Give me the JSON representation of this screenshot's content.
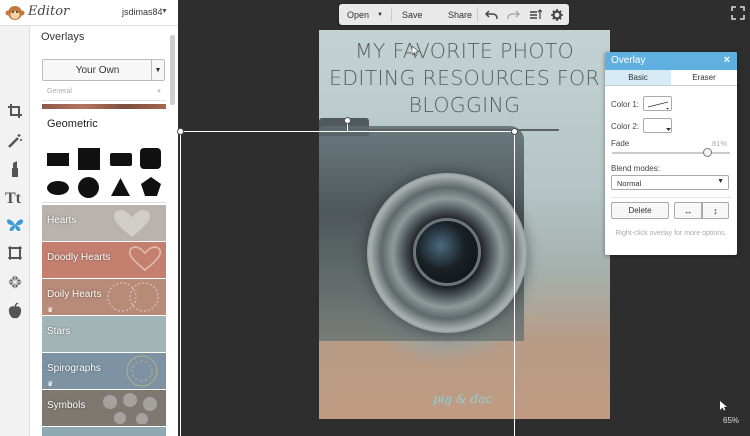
{
  "app": {
    "logo_text": "Editor",
    "username": "jsdimas84"
  },
  "panel": {
    "title": "Overlays",
    "your_own_label": "Your Own",
    "category_placeholder": "General",
    "geometric_label": "Geometric",
    "categories": [
      {
        "label": "Hearts",
        "color": "#b9b2ad",
        "premium": false
      },
      {
        "label": "Doodly Hearts",
        "color": "#c47f6f",
        "premium": false
      },
      {
        "label": "Doily Hearts",
        "color": "#b88a78",
        "premium": true
      },
      {
        "label": "Stars",
        "color": "#a2b5b7",
        "premium": false
      },
      {
        "label": "Spirographs",
        "color": "#7d93a3",
        "premium": true
      },
      {
        "label": "Symbols",
        "color": "#7e7870",
        "premium": false
      }
    ]
  },
  "toolbar": {
    "open_label": "Open",
    "save_label": "Save",
    "share_label": "Share"
  },
  "canvas": {
    "title_lines": [
      "MY FAVORITE PHOTO",
      "EDITING RESOURCES FOR",
      "BLOGGING"
    ],
    "watermark": "pig & dac"
  },
  "dialog": {
    "title": "Overlay",
    "close_label": "×",
    "tab_basic": "Basic",
    "tab_eraser": "Eraser",
    "color1_label": "Color 1:",
    "color2_label": "Color 2:",
    "fade_label": "Fade",
    "fade_value_text": "81%",
    "fade_value": 0.81,
    "blend_label": "Blend modes:",
    "blend_value": "Normal",
    "delete_label": "Delete",
    "flip_h_label": "↔",
    "flip_v_label": "↕",
    "hint": "Right-click overlay for more options."
  },
  "zoom": {
    "level": "65%"
  },
  "colors": {
    "accent": "#5fb0df",
    "active_tool": "#3d9ad6",
    "background": "#2e2e2e"
  }
}
